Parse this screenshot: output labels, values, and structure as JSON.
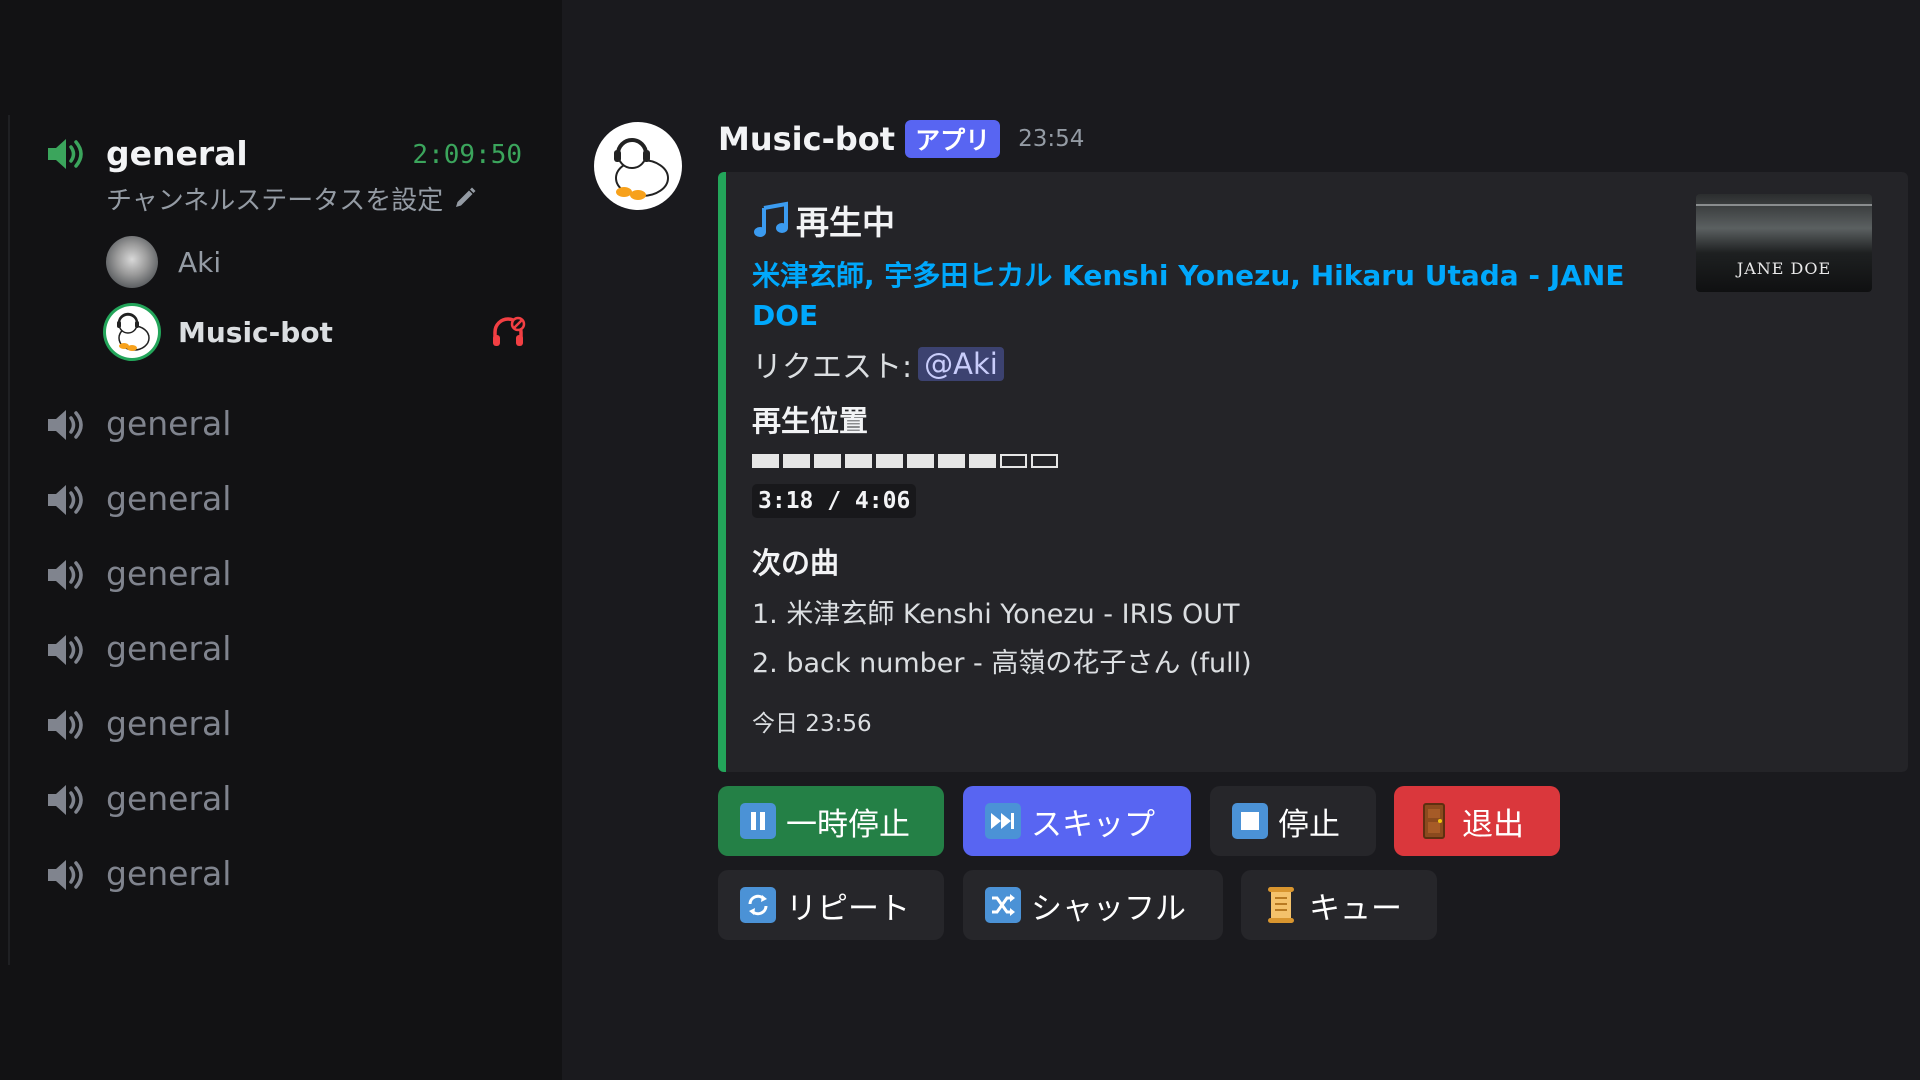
{
  "sidebar": {
    "active_channel": {
      "name": "general",
      "timer": "2:09:50",
      "status_placeholder": "チャンネルステータスを設定"
    },
    "members": [
      {
        "name": "Aki"
      },
      {
        "name": "Music-bot"
      }
    ],
    "channels": [
      {
        "name": "general"
      },
      {
        "name": "general"
      },
      {
        "name": "general"
      },
      {
        "name": "general"
      },
      {
        "name": "general"
      },
      {
        "name": "general"
      },
      {
        "name": "general"
      }
    ]
  },
  "message": {
    "author": "Music-bot",
    "tag": "アプリ",
    "time": "23:54",
    "embed": {
      "title": "再生中",
      "song": "米津玄師, 宇多田ヒカル Kenshi Yonezu, Hikaru Utada - JANE DOE",
      "requester_label": "リクエスト:",
      "requester": "@Aki",
      "position_label": "再生位置",
      "progress_blocks_filled": 8,
      "progress_blocks_total": 10,
      "position_time": "3:18 / 4:06",
      "next_label": "次の曲",
      "queue": [
        "1. 米津玄師  Kenshi Yonezu - IRIS OUT",
        "2. back number - 高嶺の花子さん (full)"
      ],
      "footer": "今日 23:56",
      "thumbnail_text": "JANE DOE"
    }
  },
  "buttons": {
    "pause": "一時停止",
    "skip": "スキップ",
    "stop": "停止",
    "leave": "退出",
    "repeat": "リピート",
    "shuffle": "シャッフル",
    "queue": "キュー"
  },
  "colors": {
    "accent_green": "#23a55a",
    "blurple": "#5865f2",
    "danger": "#da373c",
    "link": "#00a8fc"
  }
}
